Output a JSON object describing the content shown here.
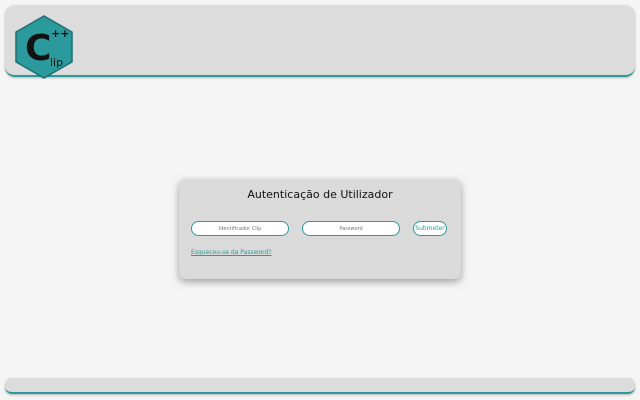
{
  "header": {
    "logo": {
      "letter": "C",
      "superscript": "++",
      "subscript": "lip",
      "hexagon_color": "#2b9a9c",
      "letter_color": "#111111"
    }
  },
  "login": {
    "title": "Autenticação de Utilizador",
    "id_field": {
      "placeholder": "Identificador Clip",
      "value": ""
    },
    "password_field": {
      "placeholder": "Password",
      "value": ""
    },
    "submit_label": "Submeter",
    "forgot_password_label": "Esqueceu-se da Password?"
  },
  "colors": {
    "accent": "#2b9a9c",
    "panel": "#dcdcdc",
    "background": "#f5f5f5"
  }
}
